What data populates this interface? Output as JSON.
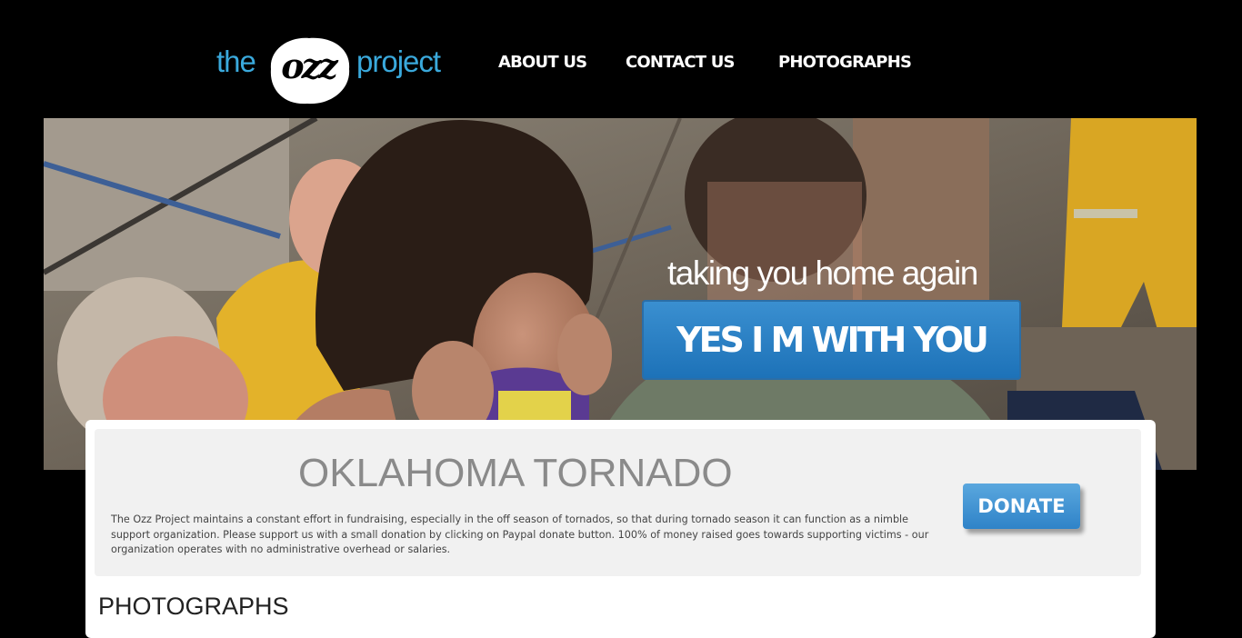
{
  "logo": {
    "prefix": "the",
    "mark": "ozz",
    "suffix": "project"
  },
  "nav": [
    {
      "label": "ABOUT US"
    },
    {
      "label": "CONTACT US"
    },
    {
      "label": "PHOTOGRAPHS"
    }
  ],
  "hero": {
    "tagline": "taking you home again",
    "cta_label": "YES I M WITH YOU"
  },
  "main": {
    "title": "OKLAHOMA TORNADO",
    "description": "The Ozz Project maintains a constant effort in fundraising, especially in the off season of tornados, so that during tornado season it can function as a nimble support organization. Please support us with a small donation by clicking on Paypal donate button. 100% of money raised goes towards supporting victims - our organization operates with no administrative overhead or salaries.",
    "donate_label": "DONATE",
    "photos_heading": "PHOTOGRAPHS"
  },
  "colors": {
    "logo_blue": "#3aa9dc",
    "cta_blue": "#1d72b8",
    "donate_blue": "#2f83c8",
    "title_gray": "#8a8a8a"
  }
}
